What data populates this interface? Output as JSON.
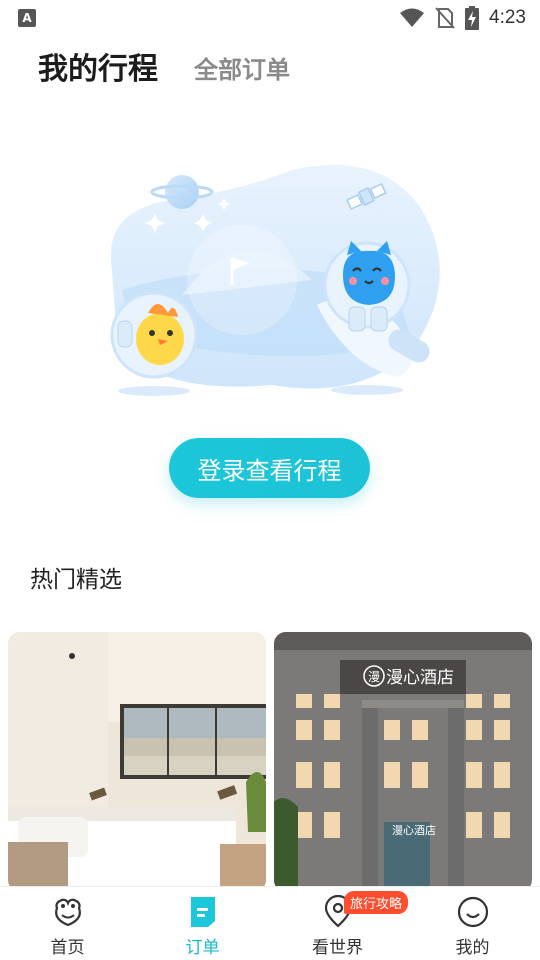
{
  "status_bar": {
    "time": "4:23",
    "left_icon_letter": "A"
  },
  "header": {
    "tab_active": "我的行程",
    "tab_inactive": "全部订单"
  },
  "login_button": {
    "label": "登录查看行程"
  },
  "section": {
    "title": "热门精选"
  },
  "hotel_sign": {
    "name": "漫心酒店",
    "logo_char": "漫"
  },
  "bottom_nav": {
    "items": [
      {
        "label": "首页",
        "icon": "home-face-icon",
        "active": false
      },
      {
        "label": "订单",
        "icon": "order-icon",
        "active": true
      },
      {
        "label": "看世界",
        "icon": "location-pin-icon",
        "active": false,
        "badge": "旅行攻略"
      },
      {
        "label": "我的",
        "icon": "smiley-icon",
        "active": false
      }
    ]
  },
  "colors": {
    "accent": "#1bc7d9",
    "badge": "#ff4d2e",
    "illustration": "#cfe6fb"
  }
}
